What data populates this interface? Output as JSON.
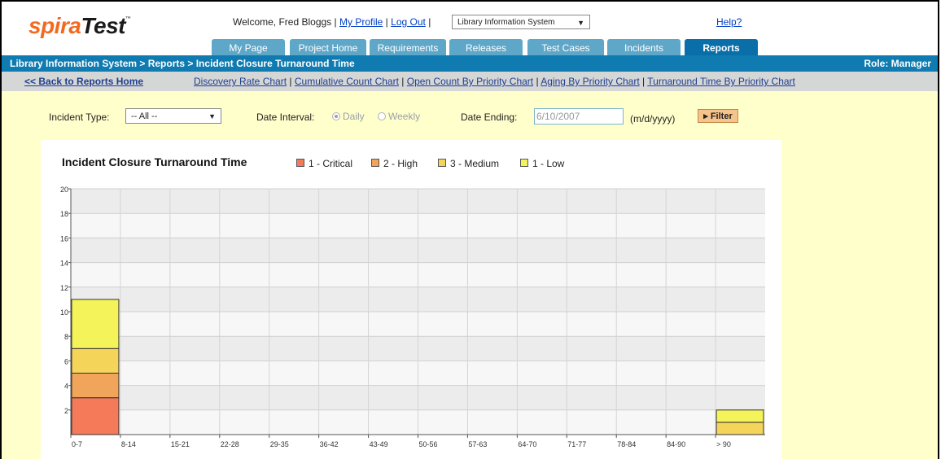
{
  "header": {
    "logo_spira": "spira",
    "logo_test": "Test",
    "logo_tm": "™",
    "welcome_text": "Welcome, Fred Bloggs",
    "sep1": "|",
    "my_profile": "My Profile",
    "sep2": "|",
    "log_out": "Log Out",
    "sep3": "|",
    "project_select": "Library Information System",
    "help": "Help?"
  },
  "tabs": [
    {
      "label": "My Page"
    },
    {
      "label": "Project Home"
    },
    {
      "label": "Requirements"
    },
    {
      "label": "Releases"
    },
    {
      "label": "Test Cases"
    },
    {
      "label": "Incidents"
    },
    {
      "label": "Reports"
    }
  ],
  "active_tab": "Reports",
  "breadcrumb": "Library Information System > Reports > Incident Closure Turnaround Time",
  "role": "Role: Manager",
  "links": {
    "back": "<< Back to Reports Home",
    "items": [
      "Discovery Rate Chart",
      "Cumulative Count Chart",
      "Open Count By Priority Chart",
      "Aging By Priority Chart",
      "Turnaround Time By Priority Chart"
    ],
    "sep": "|"
  },
  "filters": {
    "incident_type_label": "Incident Type:",
    "incident_type_value": "-- All --",
    "date_interval_label": "Date Interval:",
    "daily": "Daily",
    "weekly": "Weekly",
    "date_ending_label": "Date Ending:",
    "date_ending_value": "6/10/2007",
    "date_format": "(m/d/yyyy)",
    "filter_button": "▸ Filter"
  },
  "colors": {
    "critical": "#f47a5a",
    "high": "#f0a55a",
    "medium": "#f5d45a",
    "low": "#f4f35a"
  },
  "chart_data": {
    "type": "bar",
    "stacked": true,
    "title": "Incident Closure Turnaround Time",
    "categories": [
      "0-7",
      "8-14",
      "15-21",
      "22-28",
      "29-35",
      "36-42",
      "43-49",
      "50-56",
      "57-63",
      "64-70",
      "71-77",
      "78-84",
      "84-90",
      "> 90"
    ],
    "series": [
      {
        "name": "1 - Critical",
        "color": "#f47a5a",
        "values": [
          3,
          0,
          0,
          0,
          0,
          0,
          0,
          0,
          0,
          0,
          0,
          0,
          0,
          0
        ]
      },
      {
        "name": "2 - High",
        "color": "#f0a55a",
        "values": [
          2,
          0,
          0,
          0,
          0,
          0,
          0,
          0,
          0,
          0,
          0,
          0,
          0,
          0
        ]
      },
      {
        "name": "3 - Medium",
        "color": "#f5d45a",
        "values": [
          2,
          0,
          0,
          0,
          0,
          0,
          0,
          0,
          0,
          0,
          0,
          0,
          0,
          1
        ]
      },
      {
        "name": "1 - Low",
        "color": "#f4f35a",
        "values": [
          4,
          0,
          0,
          0,
          0,
          0,
          0,
          0,
          0,
          0,
          0,
          0,
          0,
          1
        ]
      }
    ],
    "yticks": [
      2,
      4,
      6,
      8,
      10,
      12,
      14,
      16,
      18,
      20
    ],
    "ylim": [
      0,
      20
    ],
    "grid": true,
    "legend_position": "top"
  }
}
